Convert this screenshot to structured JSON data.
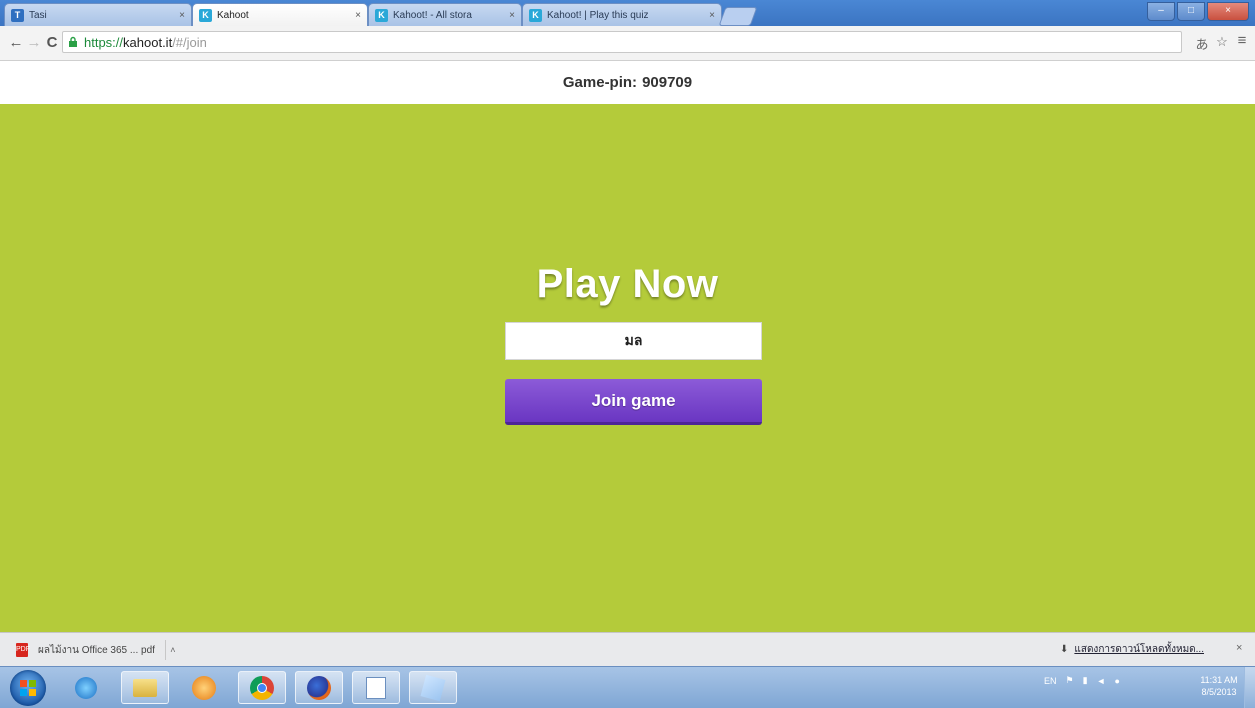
{
  "browser": {
    "tabs": [
      {
        "title": "Tasi",
        "favicon": "blue-app-icon",
        "active": false
      },
      {
        "title": "Kahoot",
        "favicon": "kahoot-icon",
        "active": true
      },
      {
        "title": "Kahoot! - All stora",
        "favicon": "kahoot-icon",
        "active": false
      },
      {
        "title": "Kahoot! | Play this quiz",
        "favicon": "kahoot-icon",
        "active": false
      }
    ],
    "tab_close_glyph": "×",
    "window_controls": {
      "minimize": "–",
      "maximize": "□",
      "close": "×"
    },
    "toolbar": {
      "back_glyph": "←",
      "forward_glyph": "→",
      "reload_glyph": "C",
      "url_scheme": "https://",
      "url_host": "kahoot.it",
      "url_path": "/#/join",
      "translate_glyph": "あ",
      "star_glyph": "☆",
      "menu_glyph": "≡"
    }
  },
  "page": {
    "game_pin_label": "Game-pin:",
    "game_pin_value": "909709",
    "heading": "Play Now",
    "nickname_value": "มล",
    "join_button_label": "Join game",
    "colors": {
      "stage_background": "#b4cb3a",
      "join_button": "#7a45cc"
    }
  },
  "download_shelf": {
    "file_name": "ผลไม้งาน Office 365 ... pdf",
    "arrow_glyph": "˄",
    "show_all_icon": "download-icon",
    "show_all_label": "แสดงการดาวน์โหลดทั้งหมด...",
    "close_glyph": "×"
  },
  "taskbar": {
    "apps": [
      "internet-explorer-icon",
      "file-explorer-icon",
      "media-player-icon",
      "chrome-icon",
      "firefox-icon",
      "powerpoint-icon",
      "paint-icon"
    ],
    "tray": {
      "language": "EN",
      "clock_time": "11:31 AM",
      "clock_date": "8/5/2013"
    }
  }
}
